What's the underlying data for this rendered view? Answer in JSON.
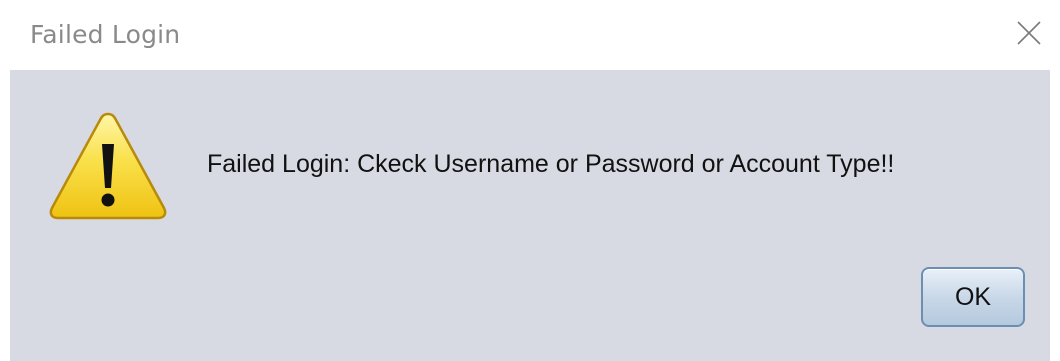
{
  "window": {
    "title": "Failed Login"
  },
  "dialog": {
    "icon": "warning-icon",
    "message": "Failed Login: Ckeck Username or Password or Account Type!!",
    "ok_label": "OK"
  },
  "colors": {
    "content_background": "#d7dae2",
    "warning_yellow": "#f6d21a",
    "button_border": "#6b8fb3"
  }
}
